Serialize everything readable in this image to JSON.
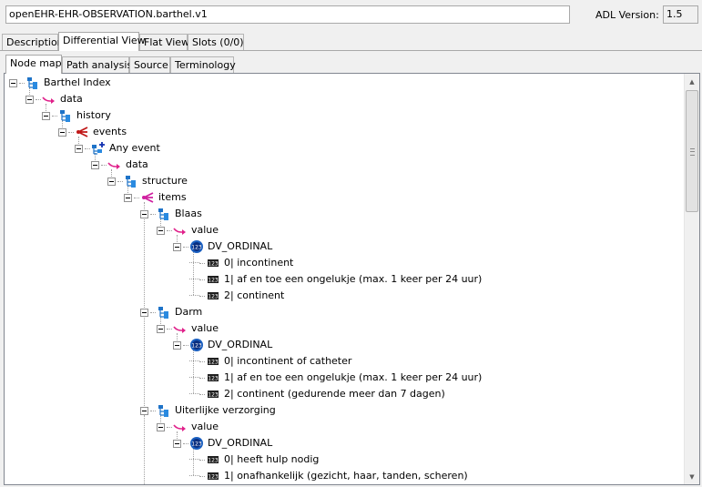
{
  "header": {
    "archetype_id": "openEHR-EHR-OBSERVATION.barthel.v1",
    "adl_version_label": "ADL Version:",
    "adl_version_value": "1.5"
  },
  "main_tabs": [
    {
      "label": "Description",
      "active": false
    },
    {
      "label": "Differential View",
      "active": true
    },
    {
      "label": "Flat View",
      "active": false
    },
    {
      "label": "Slots (0/0)",
      "active": false
    }
  ],
  "sub_tabs": [
    {
      "label": "Node map",
      "active": true
    },
    {
      "label": "Path analysis",
      "active": false
    },
    {
      "label": "Source",
      "active": false
    },
    {
      "label": "Terminology",
      "active": false
    }
  ],
  "tree": [
    {
      "level": 0,
      "label": "Barthel Index",
      "icon": "archetype-root-icon",
      "expandable": true
    },
    {
      "level": 1,
      "label": "data",
      "icon": "attribute-arrow-icon",
      "expandable": true
    },
    {
      "level": 2,
      "label": "history",
      "icon": "history-node-icon",
      "expandable": true
    },
    {
      "level": 3,
      "label": "events",
      "icon": "multiple-attribute-icon",
      "expandable": true
    },
    {
      "level": 4,
      "label": "Any event",
      "icon": "event-node-icon",
      "expandable": true
    },
    {
      "level": 5,
      "label": "data",
      "icon": "attribute-arrow-icon",
      "expandable": true
    },
    {
      "level": 6,
      "label": "structure",
      "icon": "structure-node-icon",
      "expandable": true
    },
    {
      "level": 7,
      "label": "items",
      "icon": "items-attribute-icon",
      "expandable": true
    },
    {
      "level": 8,
      "label": "Blaas",
      "icon": "element-node-icon",
      "expandable": true
    },
    {
      "level": 9,
      "label": "value",
      "icon": "attribute-arrow-icon",
      "expandable": true
    },
    {
      "level": 10,
      "label": "DV_ORDINAL",
      "icon": "ordinal-datatype-icon",
      "expandable": true
    },
    {
      "level": 11,
      "label": "0| incontinent",
      "icon": "ordinal-item-icon",
      "expandable": false
    },
    {
      "level": 11,
      "label": "1| af en toe een ongelukje (max. 1 keer per 24 uur)",
      "icon": "ordinal-item-icon",
      "expandable": false
    },
    {
      "level": 11,
      "label": "2| continent",
      "icon": "ordinal-item-icon",
      "expandable": false
    },
    {
      "level": 8,
      "label": "Darm",
      "icon": "element-node-icon",
      "expandable": true
    },
    {
      "level": 9,
      "label": "value",
      "icon": "attribute-arrow-icon",
      "expandable": true
    },
    {
      "level": 10,
      "label": "DV_ORDINAL",
      "icon": "ordinal-datatype-icon",
      "expandable": true
    },
    {
      "level": 11,
      "label": "0| incontinent of catheter",
      "icon": "ordinal-item-icon",
      "expandable": false
    },
    {
      "level": 11,
      "label": "1| af en toe een ongelukje (max. 1 keer per 24 uur)",
      "icon": "ordinal-item-icon",
      "expandable": false
    },
    {
      "level": 11,
      "label": "2| continent (gedurende meer dan 7 dagen)",
      "icon": "ordinal-item-icon",
      "expandable": false
    },
    {
      "level": 8,
      "label": "Uiterlijke verzorging",
      "icon": "element-node-icon",
      "expandable": true
    },
    {
      "level": 9,
      "label": "value",
      "icon": "attribute-arrow-icon",
      "expandable": true
    },
    {
      "level": 10,
      "label": "DV_ORDINAL",
      "icon": "ordinal-datatype-icon",
      "expandable": true
    },
    {
      "level": 11,
      "label": "0| heeft hulp nodig",
      "icon": "ordinal-item-icon",
      "expandable": false
    },
    {
      "level": 11,
      "label": "1| onafhankelijk (gezicht, haar, tanden, scheren)",
      "icon": "ordinal-item-icon",
      "expandable": false
    }
  ],
  "scrollbar": {
    "up_icon": "scroll-up-arrow-icon",
    "down_icon": "scroll-down-arrow-icon"
  }
}
